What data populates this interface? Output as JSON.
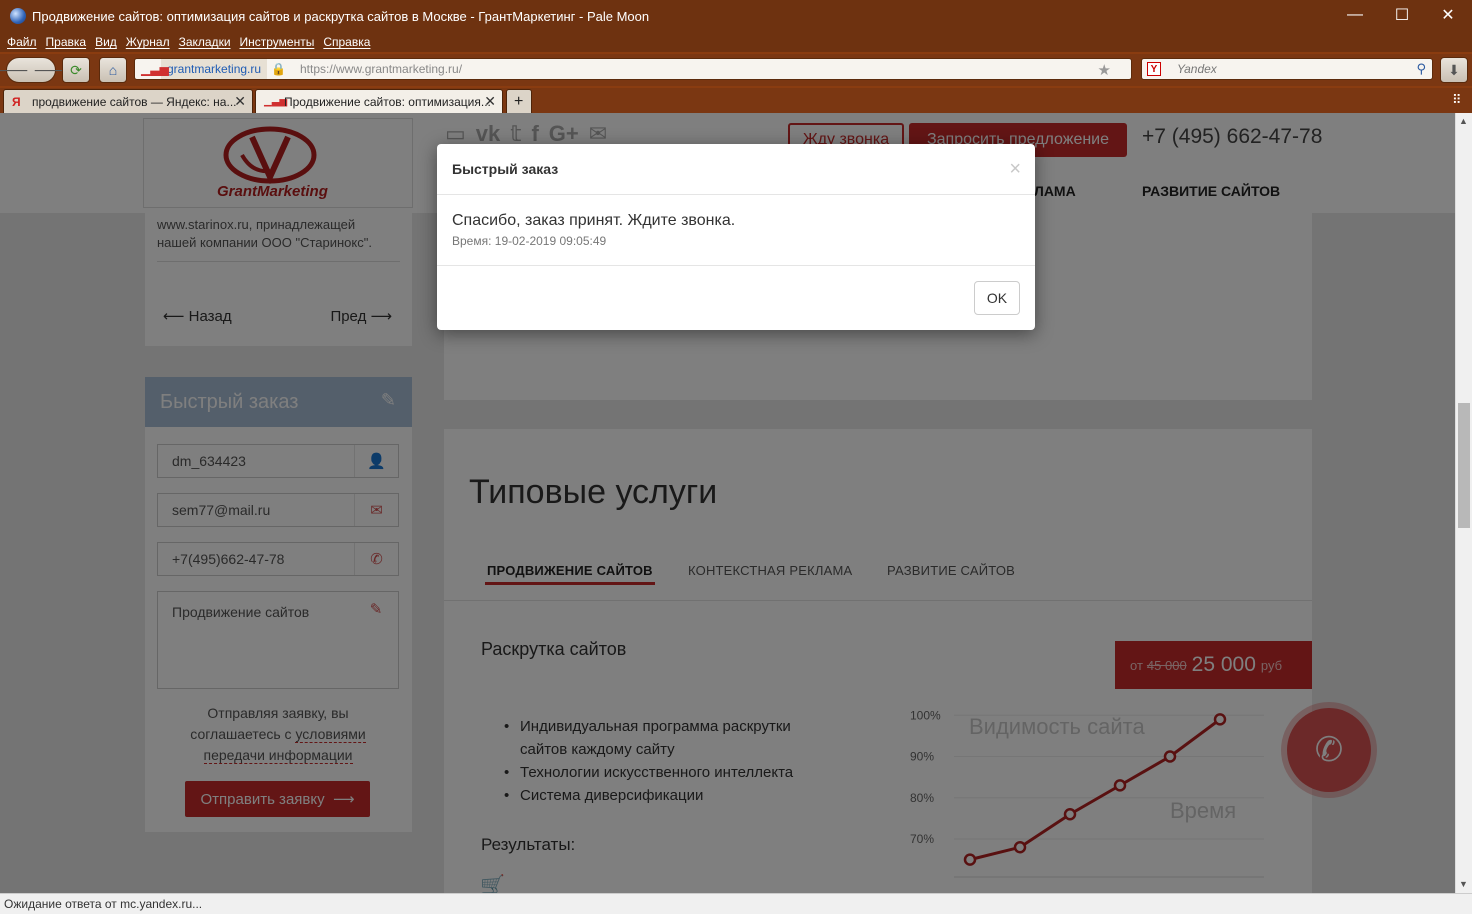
{
  "window": {
    "title": "Продвижение сайтов: оптимизация сайтов и раскрутка сайтов в Москве - ГрантМаркетинг - Pale Moon",
    "controls": {
      "minimize": "—",
      "maximize": "☐",
      "close": "✕"
    }
  },
  "menu": [
    "Файл",
    "Правка",
    "Вид",
    "Журнал",
    "Закладки",
    "Инструменты",
    "Справка"
  ],
  "toolbar": {
    "site_label": "grantmarketing.ru",
    "url": "https://www.grantmarketing.ru/",
    "search_placeholder": "Yandex",
    "search_engine_letter": "Y"
  },
  "tabs": [
    {
      "label": "продвижение сайтов — Яндекс: на...",
      "favicon": "Я"
    },
    {
      "label": "Продвижение сайтов: оптимизация...",
      "favicon": ""
    }
  ],
  "header": {
    "logo_text": "GrantMarketing",
    "call_button": "Жду звонка",
    "offer_button": "Запросить предложение",
    "phone": "+7 (495) 662-47-78",
    "nav": [
      "ЛАМА",
      "РАЗВИТИЕ САЙТОВ"
    ]
  },
  "sidebar": {
    "note": "www.starinox.ru, принадлежащей нашей компании ООО \"Старинокс\".",
    "back": "Назад",
    "prev": "Пред"
  },
  "order_form": {
    "title": "Быстрый заказ",
    "name": "dm_634423",
    "email": "sem77@mail.ru",
    "phone": "+7(495)662-47-78",
    "message": "Продвижение сайтов",
    "consent_before": "Отправляя заявку, вы соглашаетесь с ",
    "consent_link": "условиями передачи информации",
    "submit": "Отправить заявку"
  },
  "services": {
    "title": "Типовые услуги",
    "tabs": [
      "ПРОДВИЖЕНИЕ САЙТОВ",
      "КОНТЕКСТНАЯ РЕКЛАМА",
      "РАЗВИТИЕ САЙТОВ"
    ],
    "subtitle": "Раскрутка сайтов",
    "price_from": "от",
    "price_old": "45 000",
    "price_new": "25 000",
    "price_currency": "руб",
    "features": [
      "Индивидуальная программа раскрутки сайтов каждому сайту",
      "Технологии искусственного интеллекта",
      "Система диверсификации"
    ],
    "results_label": "Результаты:"
  },
  "chart_data": {
    "type": "line",
    "title": "Видимость сайта",
    "xlabel": "Время",
    "ylabel": "",
    "y_ticks": [
      "100%",
      "90%",
      "80%",
      "70%"
    ],
    "ylim": [
      62,
      102
    ],
    "values": [
      65,
      68,
      76,
      83,
      90,
      99
    ],
    "color": "#b22222"
  },
  "modal": {
    "title": "Быстрый заказ",
    "close": "×",
    "message": "Спасибо, заказ принят. Ждите звонка.",
    "time": "Время: 19-02-2019 09:05:49",
    "ok": "OK"
  },
  "status": "Ожидание ответа от mc.yandex.ru..."
}
